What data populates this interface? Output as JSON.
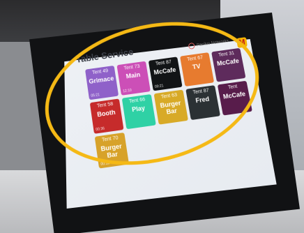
{
  "app": {
    "title": "Table Service",
    "brand_label": "Pacilus Networks",
    "logo_label": "M"
  },
  "tiles": [
    {
      "tent_label": "Tent",
      "tent_number": "49",
      "name": "Grimace",
      "time": "05:21",
      "color": "#8f61c9"
    },
    {
      "tent_label": "Tent",
      "tent_number": "73",
      "name": "Main",
      "time": "12:10",
      "color": "#cc4fb7"
    },
    {
      "tent_label": "Tent",
      "tent_number": "87",
      "name": "McCafe",
      "time": "09:21",
      "color": "#121416"
    },
    {
      "tent_label": "Tent",
      "tent_number": "67",
      "name": "TV",
      "time": "",
      "color": "#e77b2f"
    },
    {
      "tent_label": "Tent",
      "tent_number": "31",
      "name": "McCafe",
      "time": "",
      "color": "#5e2b5c"
    },
    {
      "tent_label": "Tent",
      "tent_number": "58",
      "name": "Booth",
      "time": "00:36",
      "color": "#c62b2b"
    },
    {
      "tent_label": "Tent",
      "tent_number": "66",
      "name": "Play",
      "time": "",
      "color": "#2fd1a5"
    },
    {
      "tent_label": "Tent",
      "tent_number": "63",
      "name": "Burger Bar",
      "time": "",
      "color": "#d8aa27"
    },
    {
      "tent_label": "Tent",
      "tent_number": "87",
      "name": "Fred",
      "time": "",
      "color": "#2b3134"
    },
    {
      "tent_label": "Tent",
      "tent_number": "",
      "name": "McCafe",
      "time": "",
      "color": "#581c4b"
    },
    {
      "tent_label": "Tent",
      "tent_number": "70",
      "name": "Burger Bar",
      "time": "00:18",
      "color": "#d7a22a"
    }
  ],
  "colors": {
    "highlight_ring": "#f5b915",
    "screen_bg": "#e9edf2",
    "bezel": "#111214"
  }
}
